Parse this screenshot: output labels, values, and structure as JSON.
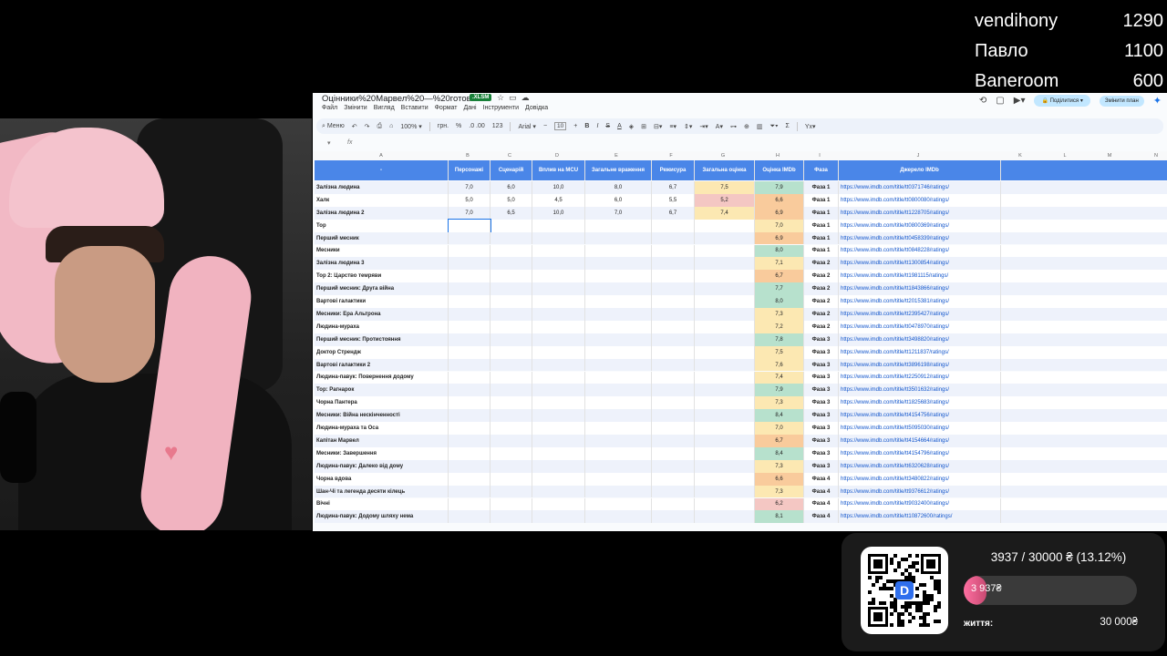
{
  "leaderboard": [
    {
      "name": "vendihony",
      "score": "1290"
    },
    {
      "name": "Павло",
      "score": "1100"
    },
    {
      "name": "Baneroom",
      "score": "600"
    }
  ],
  "sheet": {
    "title": "Оцінники%20Марвел%20—%20готово",
    "badge": ".XLSM",
    "menus": [
      "Файл",
      "Змінити",
      "Вигляд",
      "Вставити",
      "Формат",
      "Дані",
      "Інструменти",
      "Довідка"
    ],
    "share_label": "Поділитися",
    "plan_label": "Змінити план",
    "toolbar": {
      "search": "Меню",
      "zoom": "100%",
      "currency": "грн.",
      "percent": "%",
      "decimals": ".0 .00",
      "num_format": "123",
      "font": "Arial",
      "font_size": "10"
    },
    "formula_fx": "fx",
    "col_letters": [
      "A",
      "B",
      "C",
      "D",
      "E",
      "F",
      "G",
      "H",
      "I",
      "J",
      "K",
      "L",
      "M",
      "N"
    ],
    "headers": [
      "-",
      "Персонажі",
      "Сценарій",
      "Вплив на MCU",
      "Загальне враження",
      "Режисура",
      "Загальна оцінка",
      "Оцінка IMDb",
      "Фаза",
      "Джерело IMDb"
    ],
    "rows": [
      {
        "name": "Залізна людина",
        "b": "7,0",
        "c": "6,0",
        "d": "10,0",
        "e": "8,0",
        "f": "6,7",
        "g": "7,5",
        "h": "7,9",
        "phase": "Фаза 1",
        "url": "https://www.imdb.com/title/tt0371746/ratings/",
        "gc": "yellow",
        "hc": "green"
      },
      {
        "name": "Халк",
        "b": "5,0",
        "c": "5,0",
        "d": "4,5",
        "e": "6,0",
        "f": "5,5",
        "g": "5,2",
        "h": "6,6",
        "phase": "Фаза 1",
        "url": "https://www.imdb.com/title/tt0800080/ratings/",
        "gc": "red",
        "hc": "orange"
      },
      {
        "name": "Залізна людина 2",
        "b": "7,0",
        "c": "6,5",
        "d": "10,0",
        "e": "7,0",
        "f": "6,7",
        "g": "7,4",
        "h": "6,9",
        "phase": "Фаза 1",
        "url": "https://www.imdb.com/title/tt1228705/ratings/",
        "gc": "yellow",
        "hc": "orange"
      },
      {
        "name": "Тор",
        "h": "7,0",
        "phase": "Фаза 1",
        "url": "https://www.imdb.com/title/tt0800369/ratings/",
        "hc": "yellow"
      },
      {
        "name": "Перший месник",
        "h": "6,9",
        "phase": "Фаза 1",
        "url": "https://www.imdb.com/title/tt0458339/ratings/",
        "hc": "orange"
      },
      {
        "name": "Месники",
        "h": "8,0",
        "phase": "Фаза 1",
        "url": "https://www.imdb.com/title/tt0848228/ratings/",
        "hc": "green"
      },
      {
        "name": "Залізна людина 3",
        "h": "7,1",
        "phase": "Фаза 2",
        "url": "https://www.imdb.com/title/tt1300854/ratings/",
        "hc": "yellow"
      },
      {
        "name": "Тор 2: Царство темряви",
        "h": "6,7",
        "phase": "Фаза 2",
        "url": "https://www.imdb.com/title/tt1981115/ratings/",
        "hc": "orange"
      },
      {
        "name": "Перший месник: Друга війна",
        "h": "7,7",
        "phase": "Фаза 2",
        "url": "https://www.imdb.com/title/tt1843866/ratings/",
        "hc": "green"
      },
      {
        "name": "Вартові галактики",
        "h": "8,0",
        "phase": "Фаза 2",
        "url": "https://www.imdb.com/title/tt2015381/ratings/",
        "hc": "green"
      },
      {
        "name": "Месники: Ера Альтрона",
        "h": "7,3",
        "phase": "Фаза 2",
        "url": "https://www.imdb.com/title/tt2395427/ratings/",
        "hc": "yellow"
      },
      {
        "name": "Людина-мураха",
        "h": "7,2",
        "phase": "Фаза 2",
        "url": "https://www.imdb.com/title/tt0478970/ratings/",
        "hc": "yellow"
      },
      {
        "name": "Перший месник: Протистояння",
        "h": "7,8",
        "phase": "Фаза 3",
        "url": "https://www.imdb.com/title/tt3498820/ratings/",
        "hc": "green"
      },
      {
        "name": "Доктор Стрендж",
        "h": "7,5",
        "phase": "Фаза 3",
        "url": "https://www.imdb.com/title/tt1211837/ratings/",
        "hc": "yellow"
      },
      {
        "name": "Вартові галактики 2",
        "h": "7,6",
        "phase": "Фаза 3",
        "url": "https://www.imdb.com/title/tt3896198/ratings/",
        "hc": "yellow"
      },
      {
        "name": "Людина-павук: Повернення додому",
        "h": "7,4",
        "phase": "Фаза 3",
        "url": "https://www.imdb.com/title/tt2250912/ratings/",
        "hc": "yellow"
      },
      {
        "name": "Тор: Рагнарок",
        "h": "7,9",
        "phase": "Фаза 3",
        "url": "https://www.imdb.com/title/tt3501632/ratings/",
        "hc": "green"
      },
      {
        "name": "Чорна Пантера",
        "h": "7,3",
        "phase": "Фаза 3",
        "url": "https://www.imdb.com/title/tt1825683/ratings/",
        "hc": "yellow"
      },
      {
        "name": "Месники: Війна нескінченності",
        "h": "8,4",
        "phase": "Фаза 3",
        "url": "https://www.imdb.com/title/tt4154756/ratings/",
        "hc": "green"
      },
      {
        "name": "Людина-мураха та Оса",
        "h": "7,0",
        "phase": "Фаза 3",
        "url": "https://www.imdb.com/title/tt5095030/ratings/",
        "hc": "yellow"
      },
      {
        "name": "Капітан Марвел",
        "h": "6,7",
        "phase": "Фаза 3",
        "url": "https://www.imdb.com/title/tt4154664/ratings/",
        "hc": "orange"
      },
      {
        "name": "Месники: Завершення",
        "h": "8,4",
        "phase": "Фаза 3",
        "url": "https://www.imdb.com/title/tt4154796/ratings/",
        "hc": "green"
      },
      {
        "name": "Людина-павук: Далеко від дому",
        "h": "7,3",
        "phase": "Фаза 3",
        "url": "https://www.imdb.com/title/tt6320628/ratings/",
        "hc": "yellow"
      },
      {
        "name": "Чорна вдова",
        "h": "6,6",
        "phase": "Фаза 4",
        "url": "https://www.imdb.com/title/tt3480822/ratings/",
        "hc": "orange"
      },
      {
        "name": "Шан-Чі та легенда десяти кілець",
        "h": "7,3",
        "phase": "Фаза 4",
        "url": "https://www.imdb.com/title/tt9376612/ratings/",
        "hc": "yellow"
      },
      {
        "name": "Вічні",
        "h": "6,2",
        "phase": "Фаза 4",
        "url": "https://www.imdb.com/title/tt9032400/ratings/",
        "hc": "red"
      },
      {
        "name": "Людина-павук: Додому шляху нема",
        "h": "8,1",
        "phase": "Фаза 4",
        "url": "https://www.imdb.com/title/tt10872600/ratings/",
        "hc": "green"
      }
    ]
  },
  "donation": {
    "summary": "3937 / 30000 ₴ (13.12%)",
    "bar_label": "3 937₴",
    "progress_fraction": 0.1312,
    "left_label": "життя:",
    "goal_label": "30 000₴",
    "qr_letter": "D"
  }
}
